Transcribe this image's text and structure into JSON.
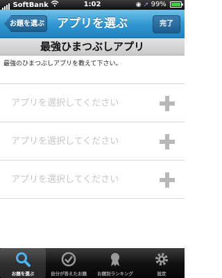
{
  "status_bar": {
    "carrier": "SoftBank",
    "time": "1:02",
    "battery": "99%",
    "battery_level": 0.99
  },
  "nav": {
    "back_label": "お題を選ぶ",
    "title": "アプリを選ぶ",
    "done_label": "完了"
  },
  "topic": {
    "title": "最強ひまつぶしアプリ",
    "description": "最強のひまつぶしアプリを教えて下さい。"
  },
  "list": {
    "items": [
      {
        "label": "アプリを選択してください"
      },
      {
        "label": "アプリを選択してください"
      },
      {
        "label": "アプリを選択してください"
      }
    ]
  },
  "tabs": [
    {
      "label": "お題を選ぶ",
      "icon": "search-icon",
      "selected": true
    },
    {
      "label": "自分が答えたお題",
      "icon": "checkmark-icon",
      "selected": false
    },
    {
      "label": "お題別ランキング",
      "icon": "ribbon-award-icon",
      "selected": false
    },
    {
      "label": "設定",
      "icon": "gear-icon",
      "selected": false
    }
  ],
  "colors": {
    "nav_blue": "#2f95cf",
    "placeholder_gray": "#c6c6c6",
    "battery_green": "#3dd13d"
  }
}
